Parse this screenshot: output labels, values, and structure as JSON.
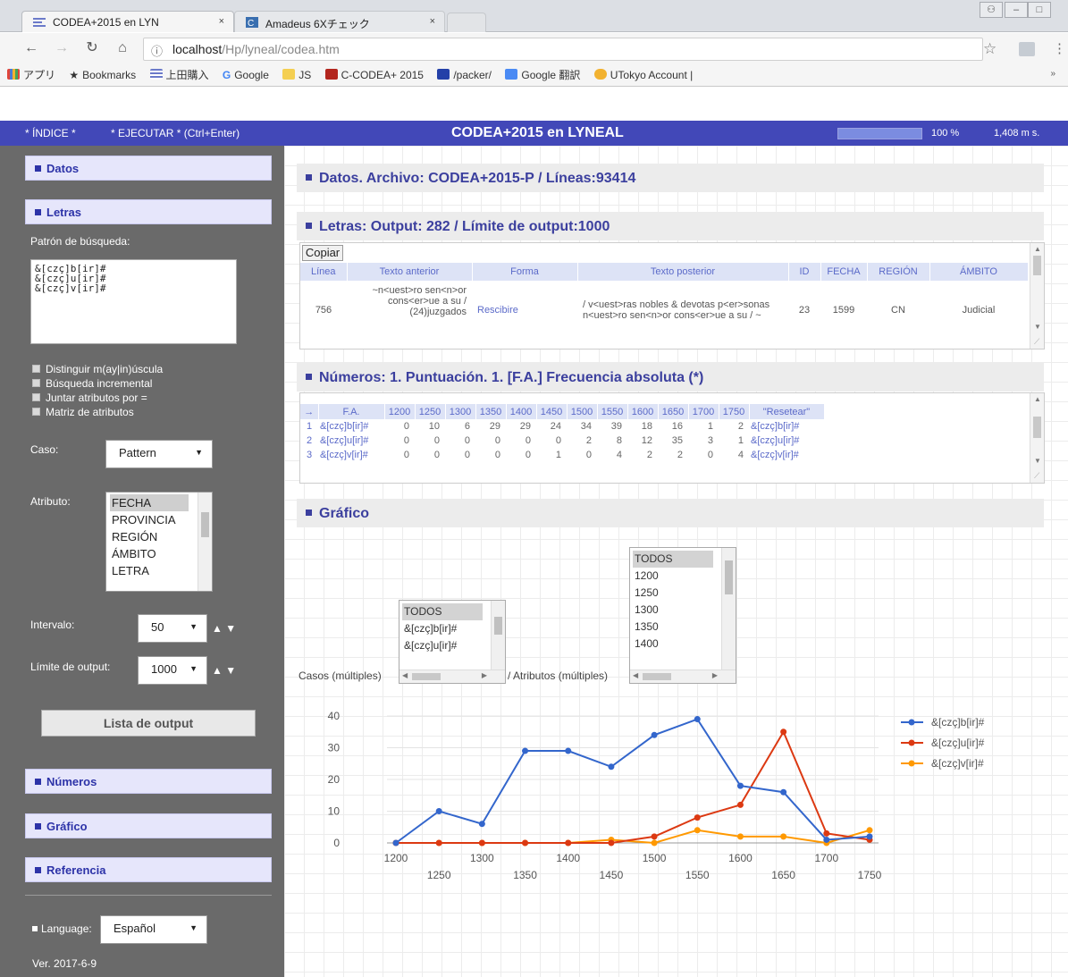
{
  "browser": {
    "tabs": [
      {
        "title": "CODEA+2015 en LYN",
        "close": "×"
      },
      {
        "title": "Amadeus 6Xチェック",
        "close": "×"
      }
    ],
    "url_host": "localhost",
    "url_path": "/Hp/lyneal/codea.htm",
    "bookmarks": [
      "アプリ",
      "Bookmarks",
      "上田購入",
      "Google",
      "JS",
      "C-CODEA+ 2015",
      "/packer/",
      "Google 翻訳",
      "UTokyo Account |"
    ]
  },
  "appbar": {
    "indice": "* ÍNDICE *",
    "ejecutar": "* EJECUTAR * (Ctrl+Enter)",
    "title": "CODEA+2015 en LYNEAL",
    "progress": 1.0,
    "percent": "100 %",
    "time": "1,408 m s."
  },
  "sidebar": {
    "datos": "Datos",
    "letras": "Letras",
    "patron_label": "Patrón de búsqueda:",
    "query": "&[czç]b[ir]#\n&[czç]u[ir]#\n&[czç]v[ir]#",
    "checkboxes": [
      "Distinguir m(ay|in)úscula",
      "Búsqueda incremental",
      "Juntar atributos por =",
      "Matriz de atributos"
    ],
    "caso_label": "Caso:",
    "caso_value": "Pattern",
    "atributo_label": "Atributo:",
    "atributos": [
      "FECHA",
      "PROVINCIA",
      "REGIÓN",
      "ÁMBITO",
      "LETRA"
    ],
    "intervalo_label": "Intervalo:",
    "intervalo_value": "50",
    "limite_label": "Límite de output:",
    "limite_value": "1000",
    "arrows": "▲ ▼",
    "lista_button": "Lista de output",
    "numeros": "Números",
    "grafico": "Gráfico",
    "referencia": "Referencia",
    "language_label": "Language:",
    "language_value": "Español",
    "version": "Ver. 2017-6-9"
  },
  "main": {
    "datos_head": "Datos. Archivo: CODEA+2015-P / Líneas:93414",
    "letras_head": "Letras: Output: 282 / Límite de output:1000",
    "copiar": "Copiar",
    "output_headers": [
      "Línea",
      "Texto anterior",
      "Forma",
      "Texto posterior",
      "ID",
      "FECHA",
      "REGIÓN",
      "ÁMBITO"
    ],
    "output_row": {
      "linea": "756",
      "anterior": "~n<uest>ro sen<n>or cons<er>ue a su / (24)juzgados",
      "forma": "Rescibire",
      "posterior": "/ v<uest>ras nobles & devotas p<er>sonas n<uest>ro sen<n>or cons<er>ue a su / ~",
      "id": "23",
      "fecha": "1599",
      "region": "CN",
      "ambito": "Judicial"
    },
    "numeros_head": "Números: 1. Puntuación. 1. [F.A.] Frecuencia absoluta (*)",
    "freq_headers": [
      "→",
      "F.A.",
      "1200",
      "1250",
      "1300",
      "1350",
      "1400",
      "1450",
      "1500",
      "1550",
      "1600",
      "1650",
      "1700",
      "1750",
      "\"Resetear\""
    ],
    "freq_rows": [
      {
        "n": "1",
        "form": "&[czç]b[ir]#",
        "values": [
          "0",
          "10",
          "6",
          "29",
          "29",
          "24",
          "34",
          "39",
          "18",
          "16",
          "1",
          "2"
        ],
        "link": "&[czç]b[ir]#"
      },
      {
        "n": "2",
        "form": "&[czç]u[ir]#",
        "values": [
          "0",
          "0",
          "0",
          "0",
          "0",
          "0",
          "2",
          "8",
          "12",
          "35",
          "3",
          "1"
        ],
        "link": "&[czç]u[ir]#"
      },
      {
        "n": "3",
        "form": "&[czç]v[ir]#",
        "values": [
          "0",
          "0",
          "0",
          "0",
          "0",
          "1",
          "0",
          "4",
          "2",
          "2",
          "0",
          "4"
        ],
        "link": "&[czç]v[ir]#"
      }
    ],
    "grafico_head": "Gráfico",
    "casos_label": "Casos (múltiples)",
    "casos_options": [
      "TODOS",
      "&[czç]b[ir]#",
      "&[czç]u[ir]#"
    ],
    "atributos_label": "/ Atributos (múltiples)",
    "atributos_options": [
      "TODOS",
      "1200",
      "1250",
      "1300",
      "1350",
      "1400"
    ]
  },
  "colors": {
    "brand": "#4248b8",
    "series_b": "#3366cc",
    "series_u": "#dc3912",
    "series_v": "#ff9900"
  },
  "chart_data": {
    "type": "line",
    "x": [
      1200,
      1250,
      1300,
      1350,
      1400,
      1450,
      1500,
      1550,
      1600,
      1650,
      1700,
      1750
    ],
    "x_ticks_upper": [
      "1200",
      "1300",
      "1400",
      "1500",
      "1600",
      "1700"
    ],
    "x_ticks_lower": [
      "1250",
      "1350",
      "1450",
      "1550",
      "1650",
      "1750"
    ],
    "y_ticks": [
      "0",
      "10",
      "20",
      "30",
      "40"
    ],
    "ylim": [
      0,
      40
    ],
    "legend_position": "right",
    "series": [
      {
        "name": "&[czç]b[ir]#",
        "color": "#3366cc",
        "values": [
          0,
          10,
          6,
          29,
          29,
          24,
          34,
          39,
          18,
          16,
          1,
          2
        ]
      },
      {
        "name": "&[czç]u[ir]#",
        "color": "#dc3912",
        "values": [
          0,
          0,
          0,
          0,
          0,
          0,
          2,
          8,
          12,
          35,
          3,
          1
        ]
      },
      {
        "name": "&[czç]v[ir]#",
        "color": "#ff9900",
        "values": [
          0,
          0,
          0,
          0,
          0,
          1,
          0,
          4,
          2,
          2,
          0,
          4
        ]
      }
    ]
  }
}
